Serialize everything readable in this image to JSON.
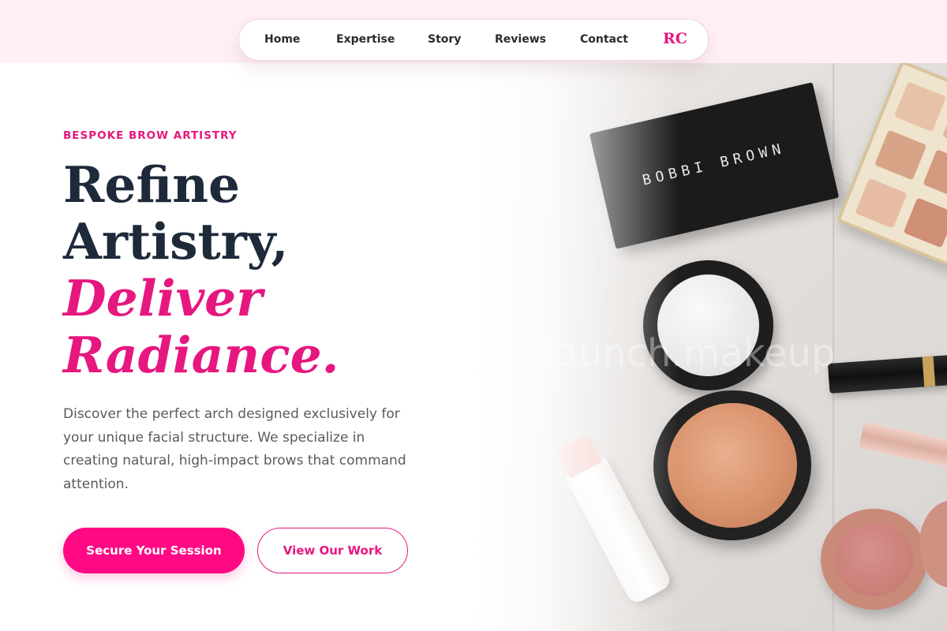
{
  "nav": {
    "items": [
      {
        "label": "Home"
      },
      {
        "label": "Expertise"
      },
      {
        "label": "Story"
      },
      {
        "label": "Reviews"
      },
      {
        "label": "Contact"
      }
    ],
    "logo": "RC"
  },
  "hero": {
    "eyebrow": "BESPOKE BROW ARTISTRY",
    "headline_line1": "Refine",
    "headline_line2": "Artistry,",
    "headline_accent_line1": "Deliver",
    "headline_accent_line2": "Radiance.",
    "description": "Discover the perfect arch designed exclusively for your unique facial structure. We specialize in creating natural, high-impact brows that command attention.",
    "primary_button": "Secure Your Session",
    "secondary_button": "View Our Work"
  },
  "image": {
    "palette_brand_text": "BOBBI BROWN",
    "watermark": "launch.makeup"
  },
  "colors": {
    "accent": "#e6177f",
    "button_primary": "#ff0a84",
    "heading_dark": "#1e2a3a",
    "top_band": "#fff0f5"
  }
}
